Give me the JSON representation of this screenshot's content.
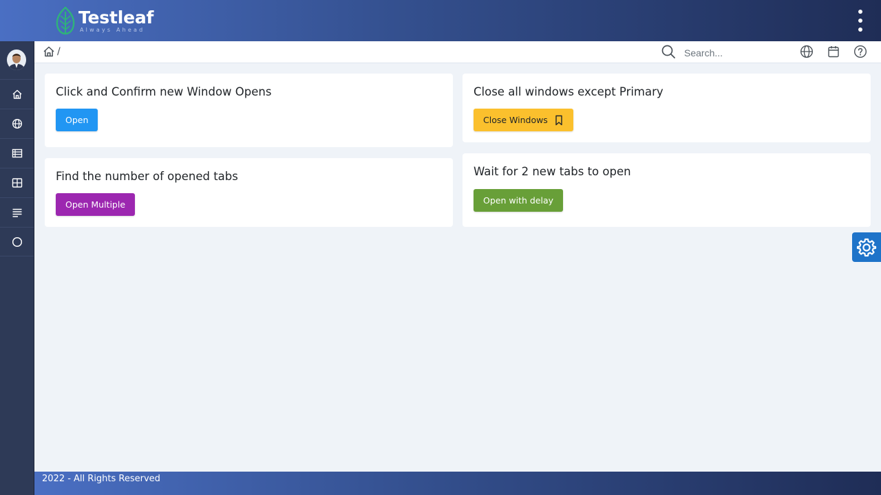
{
  "brand": {
    "name": "Testleaf",
    "tagline": "Always Ahead",
    "accent": "#2fb37a"
  },
  "header": {
    "menu_icon": "kebab-menu-icon",
    "breadcrumb_separator": "/",
    "search_placeholder": "Search...",
    "icons": [
      "search-icon",
      "globe-icon",
      "calendar-icon",
      "help-icon"
    ]
  },
  "sidebar": {
    "items": [
      {
        "icon": "home-icon"
      },
      {
        "icon": "globe-icon"
      },
      {
        "icon": "list-icon"
      },
      {
        "icon": "grid-icon"
      },
      {
        "icon": "lines-icon"
      },
      {
        "icon": "circle-icon"
      }
    ]
  },
  "cards": {
    "window_open": {
      "title": "Click and Confirm new Window Opens",
      "button": "Open",
      "color": "#2196f3"
    },
    "close_windows": {
      "title": "Close all windows except Primary",
      "button": "Close Windows",
      "color": "#fbc02d"
    },
    "tab_count": {
      "title": "Find the number of opened tabs",
      "button": "Open Multiple",
      "color": "#9c27b0"
    },
    "wait_tabs": {
      "title": "Wait for 2 new tabs to open",
      "button": "Open with delay",
      "color": "#689f38"
    }
  },
  "config_button": {
    "icon": "gear-icon",
    "color": "#1e73c9"
  },
  "footer": {
    "text": "2022 - All Rights Reserved"
  }
}
